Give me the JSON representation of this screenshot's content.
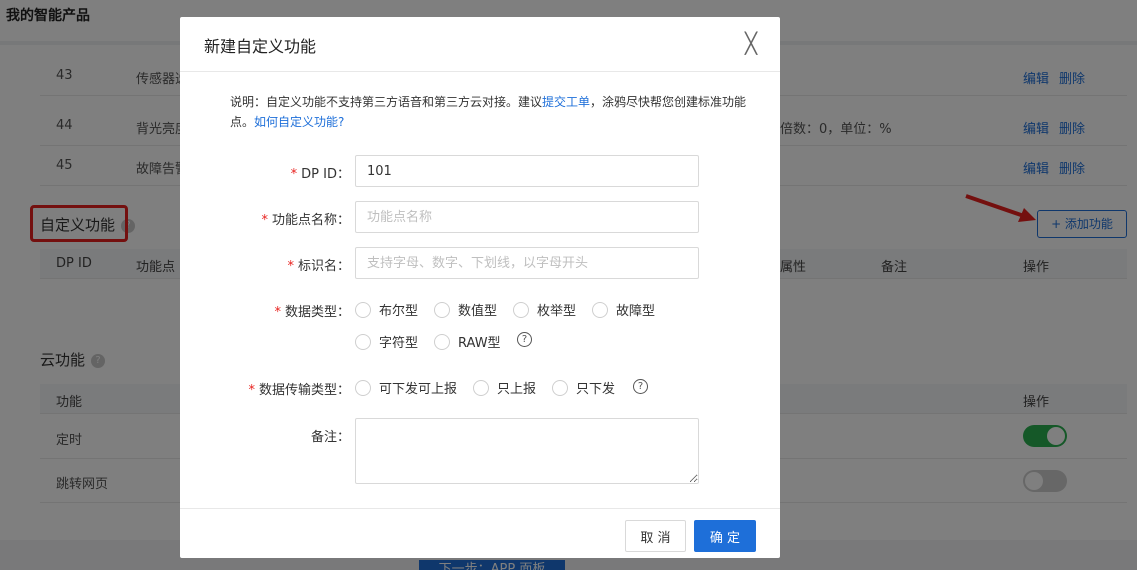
{
  "page": {
    "title": "我的智能产品"
  },
  "standard_rows": [
    {
      "id": "43",
      "name": "传感器选",
      "extra": "",
      "edit": "编辑",
      "delete": "删除"
    },
    {
      "id": "44",
      "name": "背光亮度",
      "extra": "倍数：0，单位：%",
      "edit": "编辑",
      "delete": "删除"
    },
    {
      "id": "45",
      "name": "故障告警",
      "extra": "",
      "edit": "编辑",
      "delete": "删除"
    }
  ],
  "custom_section": {
    "title": "自定义功能",
    "add_button": "+ 添加功能",
    "headers": [
      "DP ID",
      "功能点",
      "属性",
      "备注",
      "操作"
    ]
  },
  "cloud_section": {
    "title": "云功能",
    "headers": [
      "功能",
      "操作"
    ],
    "rows": [
      {
        "name": "定时",
        "enabled": true
      },
      {
        "name": "跳转网页",
        "enabled": false
      }
    ]
  },
  "next_button": "下一步：APP 面板",
  "modal": {
    "title": "新建自定义功能",
    "close": "╳",
    "desc_prefix": "说明：自定义功能不支持第三方语音和第三方云对接。建议",
    "desc_link1": "提交工单",
    "desc_mid": "，涂鸦尽快帮您创建标准功能点。",
    "desc_link2": "如何自定义功能?",
    "fields": {
      "dp_id": {
        "label": "DP ID：",
        "value": "101"
      },
      "name": {
        "label": "功能点名称：",
        "placeholder": "功能点名称"
      },
      "identifier": {
        "label": "标识名：",
        "placeholder": "支持字母、数字、下划线，以字母开头"
      },
      "data_type": {
        "label": "数据类型：",
        "options": [
          "布尔型",
          "数值型",
          "枚举型",
          "故障型",
          "字符型",
          "RAW型"
        ]
      },
      "transfer_type": {
        "label": "数据传输类型：",
        "options": [
          "可下发可上报",
          "只上报",
          "只下发"
        ]
      },
      "remark": {
        "label": "备注："
      }
    },
    "required_mark": "*",
    "help_mark": "?",
    "cancel": "取 消",
    "ok": "确 定"
  }
}
